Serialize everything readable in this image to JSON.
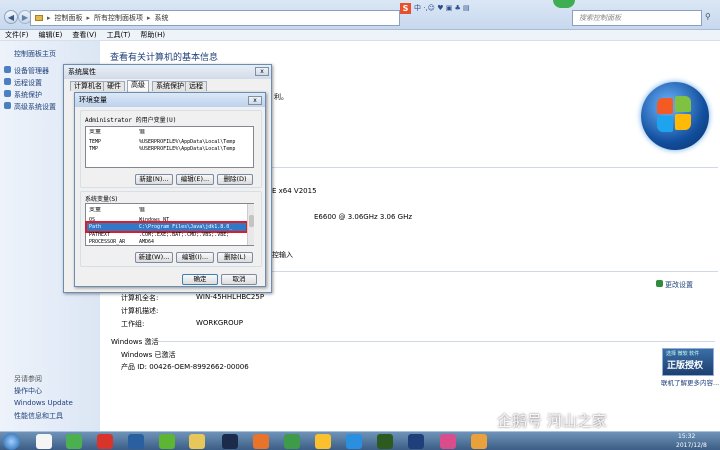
{
  "window": {
    "breadcrumb": [
      "控制面板",
      "所有控制面板项",
      "系统"
    ],
    "search_placeholder": "搜索控制面板",
    "title_icons": "中 ·,☺ ♥ ▣ ♣ ▤",
    "menu": [
      "文件(F)",
      "编辑(E)",
      "查看(V)",
      "工具(T)",
      "帮助(H)"
    ]
  },
  "left_panel": {
    "home": "控制面板主页",
    "items": [
      "设备管理器",
      "远程设置",
      "系统保护",
      "高级系统设置"
    ],
    "see_also_title": "另请参阅",
    "see_also": [
      "操作中心",
      "Windows Update",
      "性能信息和工具"
    ]
  },
  "main": {
    "heading": "查看有关计算机的基本信息",
    "fragments": [
      "利。",
      "E x64 V2015",
      "E6600 @ 3.06GHz   3.06 GHz",
      "控输入"
    ],
    "computer_rows": [
      {
        "label": "计算机全名:",
        "value": "WIN-45HHLHBC25P"
      },
      {
        "label": "计算机描述:",
        "value": ""
      },
      {
        "label": "工作组:",
        "value": "WORKGROUP"
      }
    ],
    "change_settings": "更改设置",
    "activation_title": "Windows 激活",
    "activation_status": "Windows 已激活",
    "product_id": "产品 ID: 00426-OEM-8992662-00006",
    "genuine_top": "选择 微软 软件",
    "genuine_badge": "正版授权",
    "genuine_sub": "",
    "genuine_link": "联机了解更多内容..."
  },
  "sysprops": {
    "title": "系统属性",
    "tabs": [
      "计算机名",
      "硬件",
      "高级",
      "系统保护",
      "远程"
    ],
    "close": "x"
  },
  "envvars": {
    "title": "环境变量",
    "close": "x",
    "user_group": "Administrator 的用户变量(U)",
    "col_var": "变量",
    "col_val": "值",
    "user_vars": [
      {
        "name": "TEMP",
        "value": "%USERPROFILE%\\AppData\\Local\\Temp"
      },
      {
        "name": "TMP",
        "value": "%USERPROFILE%\\AppData\\Local\\Temp"
      }
    ],
    "btn_new_user": "新建(N)...",
    "btn_edit_user": "编辑(E)...",
    "btn_delete_user": "删除(D)",
    "sys_group": "系统变量(S)",
    "sys_vars": [
      {
        "name": "OS",
        "value": "Windows_NT"
      },
      {
        "name": "Path",
        "value": "C:\\Program Files\\Java\\jdk1.8.0_"
      },
      {
        "name": "PATHEXT",
        "value": ".COM;.EXE;.BAT;.CMD;.VBS;.VBE;"
      },
      {
        "name": "PROCESSOR_AR",
        "value": "AMD64"
      }
    ],
    "btn_new_sys": "新建(W)...",
    "btn_edit_sys": "编辑(I)...",
    "btn_delete_sys": "删除(L)",
    "ok": "确定",
    "cancel": "取消"
  },
  "taskbar": {
    "time": "15:32",
    "date": "2017/12/8"
  },
  "watermark": "企鹅号 河山之家"
}
